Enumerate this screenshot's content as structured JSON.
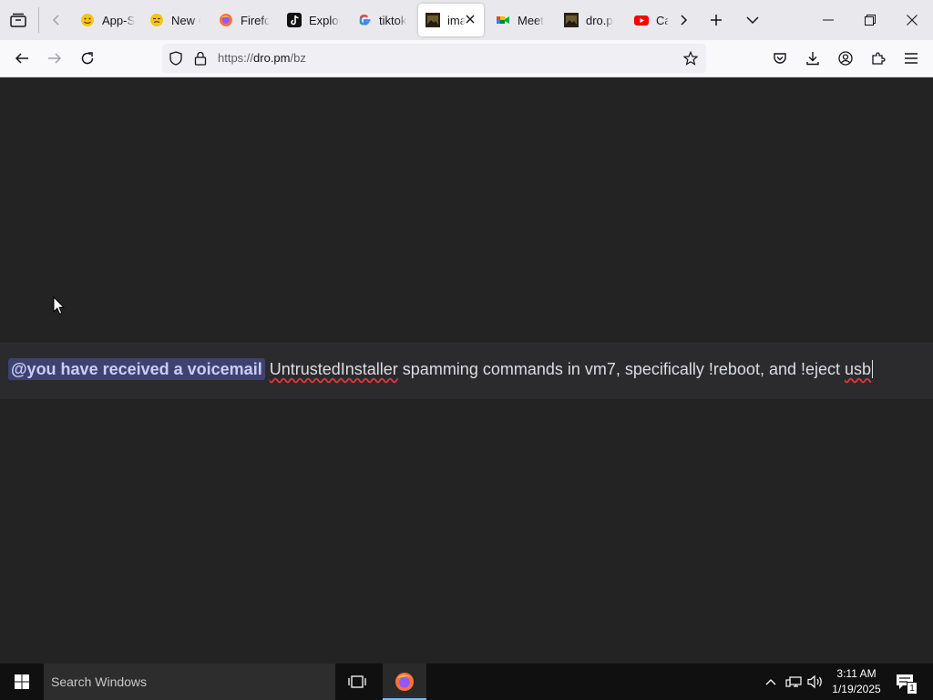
{
  "tabs": [
    {
      "label": "App-S",
      "icon": "emoji-icon"
    },
    {
      "label": "New C",
      "icon": "emoji-icon"
    },
    {
      "label": "Firefo",
      "icon": "firefox-icon"
    },
    {
      "label": "Explor",
      "icon": "tiktok-icon"
    },
    {
      "label": "tiktok",
      "icon": "google-icon"
    },
    {
      "label": "ima",
      "icon": "image-icon",
      "active": true
    },
    {
      "label": "Meet",
      "icon": "meet-icon"
    },
    {
      "label": "dro.p",
      "icon": "image-icon"
    },
    {
      "label": "Cav",
      "icon": "youtube-icon"
    }
  ],
  "address_bar": {
    "url_prefix": "https://",
    "url_host": "dro.pm",
    "url_path": "/bz"
  },
  "message": {
    "mention": "@you have received a voicemail",
    "word1": "UntrustedInstaller",
    "middle": " spamming commands in vm7, specifically !reboot, and !eject ",
    "word2": "usb"
  },
  "taskbar": {
    "search_placeholder": "Search Windows",
    "time": "3:11 AM",
    "date": "1/19/2025",
    "notification_count": "1"
  },
  "colors": {
    "accent": "#0060df",
    "mention_bg": "#3d4270",
    "firefox_indicator": "#76b9ed"
  }
}
